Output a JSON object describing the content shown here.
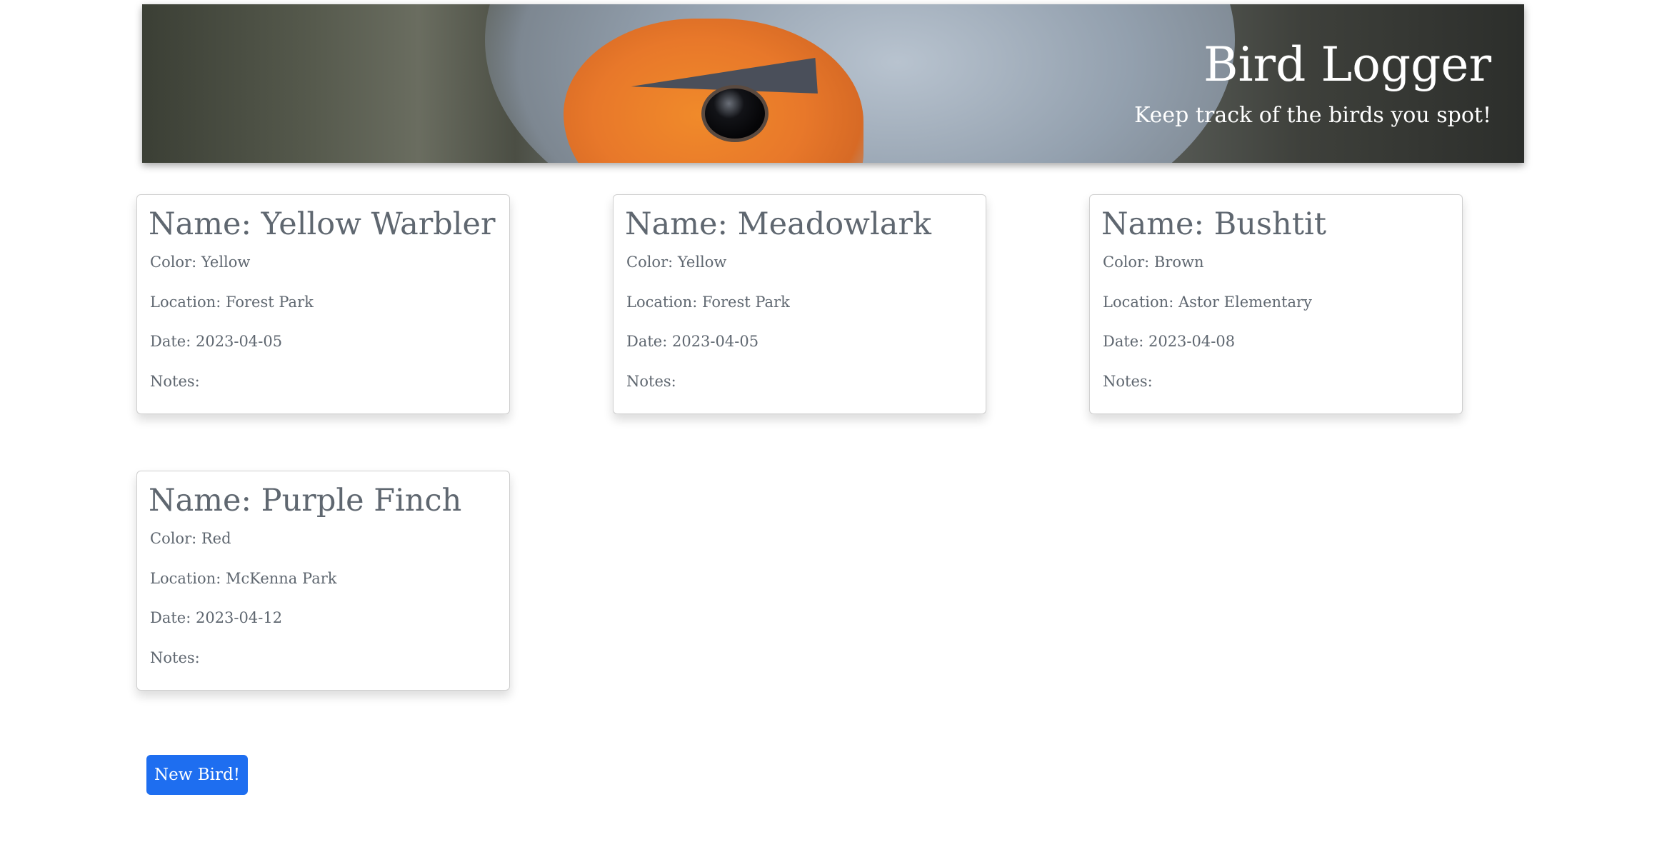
{
  "header": {
    "title": "Bird Logger",
    "subtitle": "Keep track of the birds you spot!"
  },
  "birds": [
    {
      "name": "Name: Yellow Warbler",
      "color": "Color: Yellow",
      "location": "Location: Forest Park",
      "date": "Date: 2023-04-05",
      "notes": "Notes:"
    },
    {
      "name": "Name: Meadowlark",
      "color": "Color: Yellow",
      "location": "Location: Forest Park",
      "date": "Date: 2023-04-05",
      "notes": "Notes:"
    },
    {
      "name": "Name: Bushtit",
      "color": "Color: Brown",
      "location": "Location: Astor Elementary",
      "date": "Date: 2023-04-08",
      "notes": "Notes:"
    },
    {
      "name": "Name: Purple Finch",
      "color": "Color: Red",
      "location": "Location: McKenna Park",
      "date": "Date: 2023-04-12",
      "notes": "Notes:"
    }
  ],
  "actions": {
    "new_bird_label": "New Bird!"
  },
  "colors": {
    "accent": "#1e6ef0",
    "card_text": "#5f6770"
  }
}
